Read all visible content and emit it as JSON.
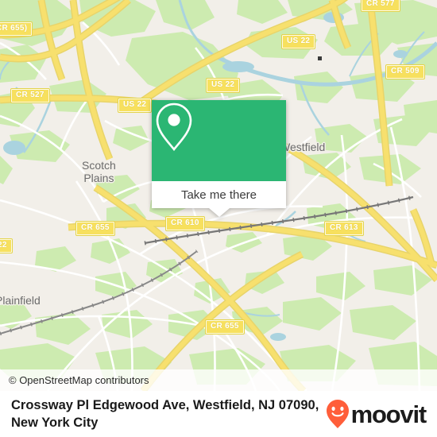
{
  "map": {
    "attribution": "© OpenStreetMap contributors",
    "background_color": "#f2efe9",
    "green_color": "#cdebb0",
    "water_color": "#aad3df",
    "road_color": "#f7e06e",
    "places": [
      {
        "name": "Scotch Plains",
        "line1": "Scotch",
        "line2": "Plains"
      },
      {
        "name": "Westfield",
        "line1": "Westfield",
        "line2": ""
      },
      {
        "name": "Plainfield",
        "line1": "Plainfield",
        "line2": ""
      }
    ],
    "shields": [
      {
        "label": "CR 655)"
      },
      {
        "label": "CR 527"
      },
      {
        "label": "US 22"
      },
      {
        "label": "US 22"
      },
      {
        "label": "US 22"
      },
      {
        "label": "CR 577"
      },
      {
        "label": "CR 509"
      },
      {
        "label": "CR 655"
      },
      {
        "label": "CR 610"
      },
      {
        "label": "CR 613"
      },
      {
        "label": "22"
      },
      {
        "label": "CR 655"
      }
    ]
  },
  "popup": {
    "marker_icon": "map-pin-icon",
    "cta_label": "Take me there",
    "accent_color": "#2bb673"
  },
  "footer": {
    "title": "Crossway Pl Edgewood Ave, Westfield, NJ 07090, New York City",
    "brand_name": "moovit",
    "brand_icon": "moovit-pin-smiley-icon",
    "brand_color": "#ff5e3a"
  }
}
